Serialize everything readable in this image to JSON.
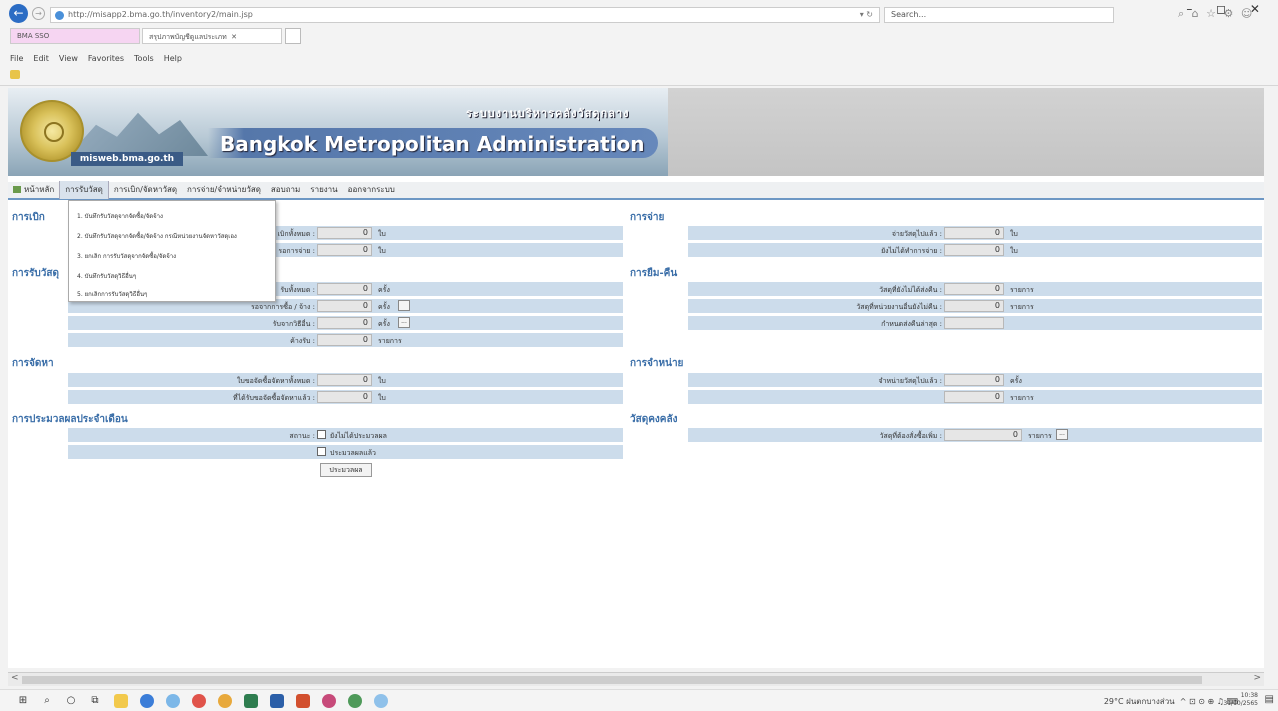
{
  "browser": {
    "url": "http://misapp2.bma.go.th/inventory2/main.jsp",
    "search_placeholder": "Search...",
    "tabs": [
      {
        "label": "BMA SSO"
      },
      {
        "label": "สรุปภาพบัญชีดูแลประเภท"
      }
    ],
    "menu": [
      "File",
      "Edit",
      "View",
      "Favorites",
      "Tools",
      "Help"
    ],
    "window_buttons": "– ◻ ✕",
    "tool_icons": "⌕ ⌂ ☆ ⚙ ☺"
  },
  "header": {
    "thai_title": "ระบบงานบริหารคลังวัสดุกลาง",
    "title": "Bangkok Metropolitan Administration",
    "site": "misweb.bma.go.th"
  },
  "nav": [
    "หน้าหลัก",
    "การรับวัสดุ",
    "การเบิก/จัดหาวัสดุ",
    "การจ่าย/จำหน่ายวัสดุ",
    "สอบถาม",
    "รายงาน",
    "ออกจากระบบ"
  ],
  "dropdown": [
    "1. บันทึกรับวัสดุจากจัดซื้อ/จัดจ้าง",
    "2. บันทึกรับวัสดุจากจัดซื้อ/จัดจ้าง กรณีหน่วยงานจัดหาวัสดุเอง",
    "3. ยกเลิก การรับวัสดุจากจัดซื้อ/จัดจ้าง",
    "4. บันทึกรับวัสดุวิธีอื่นๆ",
    "5. ยกเลิกการรับวัสดุวิธีอื่นๆ"
  ],
  "sections": {
    "withdraw": {
      "title": "การเบิก",
      "rows": [
        {
          "label": "เบิกทั้งหมด :",
          "value": "0",
          "unit": "ใบ"
        },
        {
          "label": "รอการจ่าย :",
          "value": "0",
          "unit": "ใบ"
        }
      ]
    },
    "receive": {
      "title": "การรับวัสดุ",
      "rows": [
        {
          "label": "รับทั้งหมด :",
          "value": "0",
          "unit": "ครั้ง"
        },
        {
          "label": "รอจากการซื้อ / จ้าง :",
          "value": "0",
          "unit": "ครั้ง"
        },
        {
          "label": "รับจากวิธีอื่น :",
          "value": "0",
          "unit": "ครั้ง"
        },
        {
          "label": "ค้างรับ :",
          "value": "0",
          "unit": "รายการ"
        }
      ]
    },
    "procure": {
      "title": "การจัดหา",
      "rows": [
        {
          "label": "ใบขอจัดซื้อจัดหาทั้งหมด :",
          "value": "0",
          "unit": "ใบ"
        },
        {
          "label": "ที่ได้รับขอจัดซื้อจัดหาแล้ว :",
          "value": "0",
          "unit": "ใบ"
        }
      ]
    },
    "monthly": {
      "title": "การประมวลผลประจำเดือน",
      "status_label": "สถานะ :",
      "options": [
        "ยังไม่ได้ประมวลผล",
        "ประมวลผลแล้ว"
      ],
      "button": "ประมวลผล"
    },
    "payout": {
      "title": "การจ่าย",
      "rows": [
        {
          "label": "จ่ายวัสดุไปแล้ว :",
          "value": "0",
          "unit": "ใบ"
        },
        {
          "label": "ยังไม่ได้ทำการจ่าย :",
          "value": "0",
          "unit": "ใบ"
        }
      ]
    },
    "borrow": {
      "title": "การยืม-คืน",
      "rows": [
        {
          "label": "วัสดุที่ยังไม่ได้ส่งคืน :",
          "value": "0",
          "unit": "รายการ"
        },
        {
          "label": "วัสดุที่หน่วยงานอื่นยังไม่คืน :",
          "value": "0",
          "unit": "รายการ"
        },
        {
          "label": "กำหนดส่งคืนล่าสุด :",
          "value": "",
          "unit": ""
        }
      ]
    },
    "dispose": {
      "title": "การจำหน่าย",
      "rows": [
        {
          "label": "จำหน่ายวัสดุไปแล้ว :",
          "value": "0",
          "unit": "ครั้ง"
        },
        {
          "label": "",
          "value": "0",
          "unit": "รายการ"
        }
      ]
    },
    "stock": {
      "title": "วัสดุคงคลัง",
      "rows": [
        {
          "label": "วัสดุที่ต้องสั่งซื้อเพิ่ม :",
          "value": "0",
          "unit": "รายการ"
        }
      ]
    }
  },
  "taskbar": {
    "weather": "29°C ฝนตกบางส่วน",
    "time": "10:38",
    "date": "31/10/2565"
  }
}
